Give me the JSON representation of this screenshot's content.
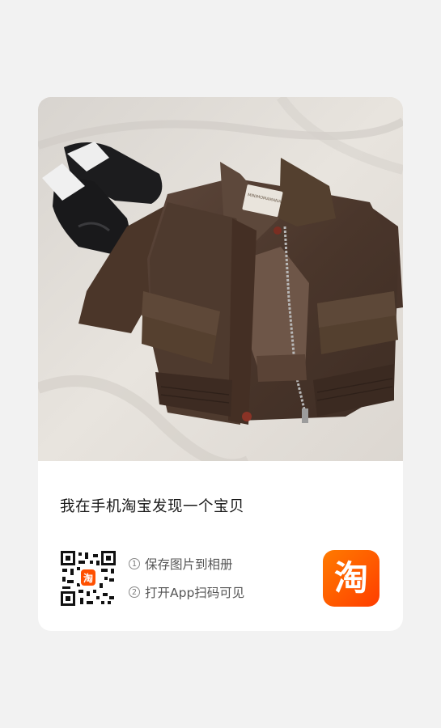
{
  "share_card": {
    "title": "我在手机淘宝发现一个宝贝",
    "steps": [
      {
        "number": "1",
        "label": "保存图片到相册"
      },
      {
        "number": "2",
        "label": "打开App扫码可见"
      }
    ],
    "qr_badge_glyph": "淘",
    "app_logo_glyph": "淘"
  },
  "product_image": {
    "subject": "brown leather cropped jacket with black loafers",
    "tag_text": "MINIMOMAMANA"
  },
  "colors": {
    "accent": "#ff5000",
    "background": "#f2f2f2",
    "card": "#ffffff",
    "title_text": "#1a1a1a",
    "step_text": "#555555"
  }
}
